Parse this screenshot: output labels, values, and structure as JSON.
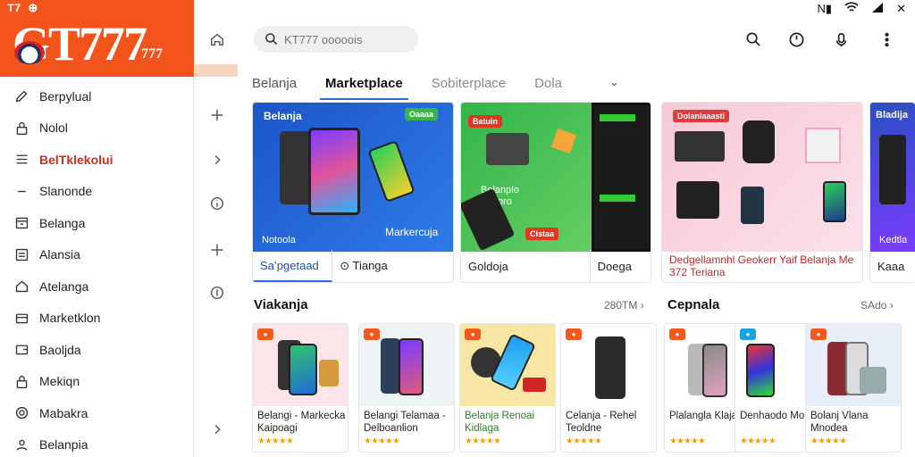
{
  "logo": {
    "status": "T7 ⊕",
    "title": "GT777",
    "sub": "777"
  },
  "sidebar": {
    "items": [
      {
        "label": "Berpylual",
        "icon": "pencil-icon"
      },
      {
        "label": "Nolol",
        "icon": "lock-icon"
      },
      {
        "label": "BelTklekolui",
        "icon": "menu-icon",
        "active": true
      },
      {
        "label": "Slanonde",
        "icon": "dash-icon"
      },
      {
        "label": "Belanga",
        "icon": "store-icon"
      },
      {
        "label": "Alansia",
        "icon": "list-icon"
      },
      {
        "label": "Atelanga",
        "icon": "home-outline-icon"
      },
      {
        "label": "Marketklon",
        "icon": "card-icon"
      },
      {
        "label": "Baoljda",
        "icon": "wallet-icon"
      },
      {
        "label": "Mekiqn",
        "icon": "lock-icon"
      },
      {
        "label": "Mabakra",
        "icon": "settings-icon"
      },
      {
        "label": "Belanpia",
        "icon": "user-icon"
      }
    ]
  },
  "search": {
    "placeholder": "KT777 ooooois"
  },
  "status_bar": {
    "battery": "N▮",
    "wifi": "wifi",
    "signal": "signal",
    "close": "✕"
  },
  "tabs": [
    {
      "label": "Belanja"
    },
    {
      "label": "Marketplace",
      "active": true
    },
    {
      "label": "Sobiterplace",
      "muted": true
    },
    {
      "label": "Dola",
      "muted": true
    }
  ],
  "banners": [
    {
      "art_title": "Belanja",
      "art_caption": "Notoola",
      "art_right": "Markercuja",
      "pill": "Oaaaa",
      "footer": [
        "Saʻpgetaad",
        "⊙ Tianga"
      ]
    },
    {
      "art_title": "Belanplo Bakoro",
      "pill": "Batuin",
      "pill2": "Cistaa",
      "footer": [
        "Goldoja",
        "Doega"
      ]
    },
    {
      "art_title": "Dolanlaaasti",
      "footer_text": "Dedgellamnhl Geokerr Yaif Belanja Me 372 Teriana"
    },
    {
      "art_title": "Bladija",
      "art_caption": "Kedtla",
      "footer": [
        "Kaaa"
      ]
    }
  ],
  "sections": [
    {
      "title": "Viakanja",
      "more": "280TM"
    },
    {
      "title": "Cepnala",
      "more": "SAdo"
    }
  ],
  "products": [
    {
      "name": "Belangi - Markecka Kaipoagi",
      "rating": "★★★★★",
      "badge_color": "#f25a1c"
    },
    {
      "name": "Belangi Telamaa - Delboanlion",
      "rating": "★★★★★",
      "badge_color": "#f25a1c"
    },
    {
      "name": "Belanja Renoai Kidlaga",
      "rating": "★★★★★",
      "badge_color": "#f25a1c"
    },
    {
      "name": "Celanja - Rehel Teoldne",
      "rating": "★★★★★",
      "badge_color": "#f25a1c"
    },
    {
      "name": "Plalangla Klajad",
      "rating": "★★★★★",
      "badge_color": "#f25a1c"
    },
    {
      "name": "Denhaodo Molkin",
      "rating": "★★★★★",
      "badge_color": "#19a4e0"
    },
    {
      "name": "Bolanj Vlana Mnodea",
      "rating": "★★★★★",
      "badge_color": "#f25a1c"
    }
  ],
  "colors": {
    "brand": "#f2541b",
    "active_nav": "#d22e1e",
    "tab_underline": "#2a6fd6",
    "star": "#f5a300"
  }
}
